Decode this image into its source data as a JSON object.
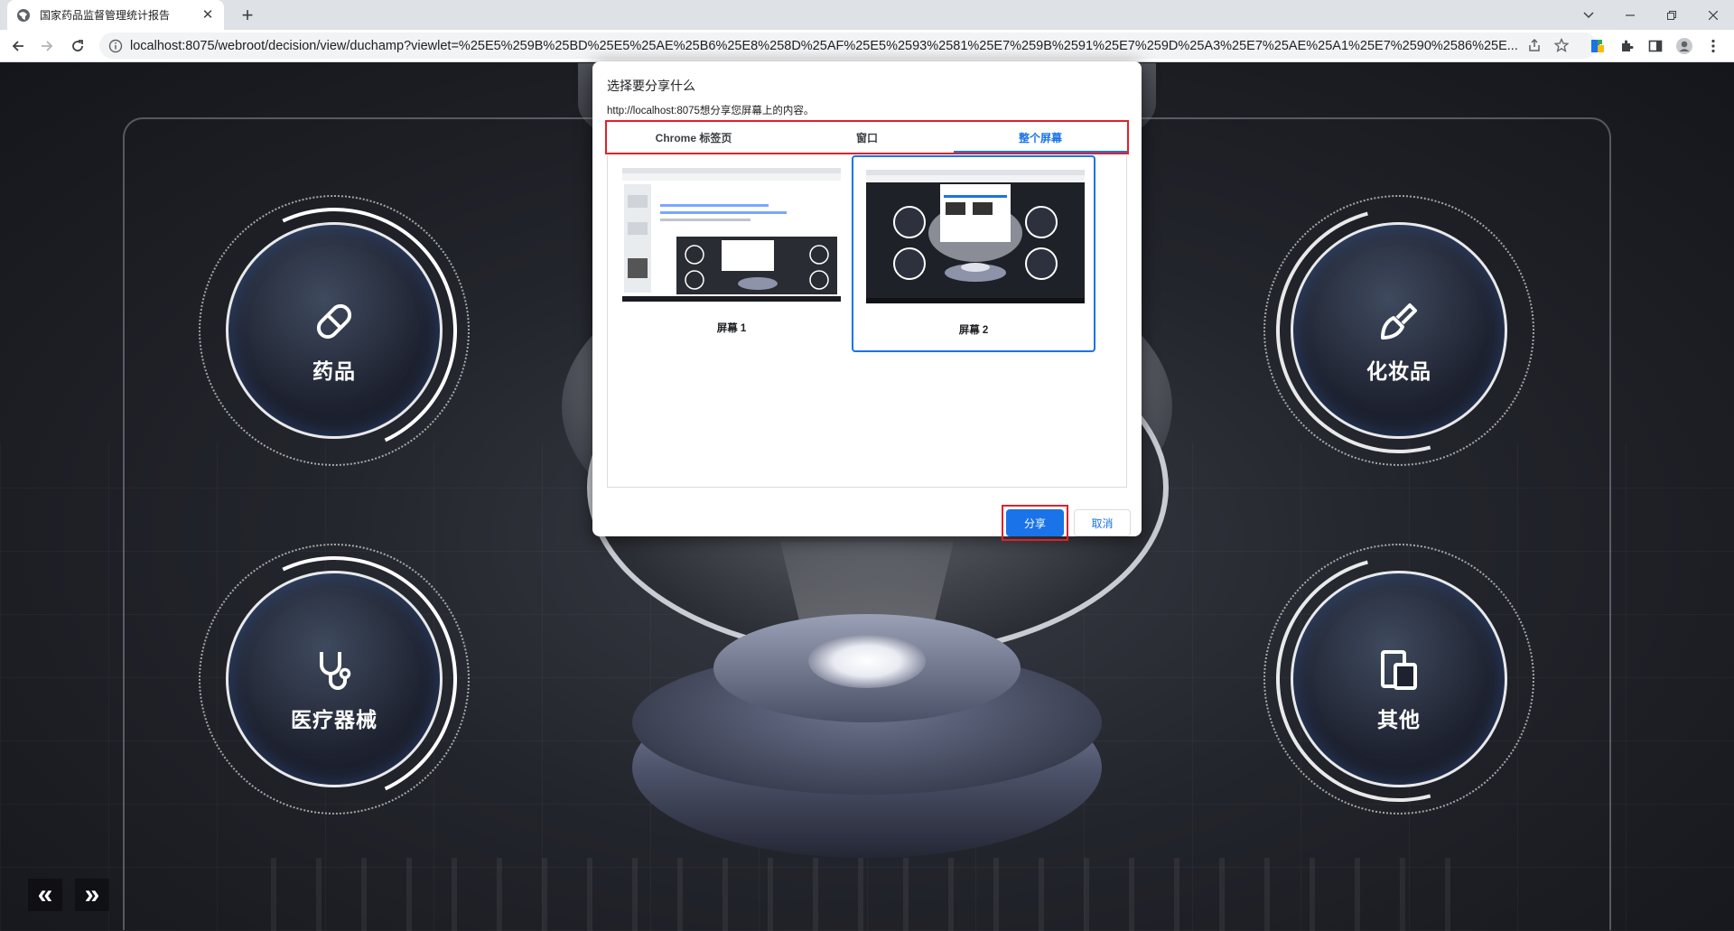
{
  "browser": {
    "tab_title": "国家药品监督管理统计报告",
    "tab_close": "✕",
    "new_tab": "+",
    "url": "localhost:8075/webroot/decision/view/duchamp?viewlet=%25E5%259B%25BD%25E5%25AE%25B6%25E8%258D%25AF%25E5%2593%2581%25E7%259B%2591%25E7%259D%25A3%25E7%25AE%25A1%25E7%2590%2586%25E..."
  },
  "dashboard": {
    "categories": [
      {
        "label": "药品",
        "icon": "pill-icon"
      },
      {
        "label": "化妆品",
        "icon": "brush-icon"
      },
      {
        "label": "医疗器械",
        "icon": "stethoscope-icon"
      },
      {
        "label": "其他",
        "icon": "devices-icon"
      }
    ],
    "pager": {
      "prev": "«",
      "next": "»"
    }
  },
  "dialog": {
    "title": "选择要分享什么",
    "subtitle": "http://localhost:8075想分享您屏幕上的内容。",
    "tabs": [
      "Chrome 标签页",
      "窗口",
      "整个屏幕"
    ],
    "active_tab": 2,
    "screens": [
      {
        "label": "屏幕 1",
        "selected": false
      },
      {
        "label": "屏幕 2",
        "selected": true
      }
    ],
    "share_label": "分享",
    "cancel_label": "取消"
  },
  "colors": {
    "accent": "#1a73e8",
    "highlight": "#e0202a"
  }
}
